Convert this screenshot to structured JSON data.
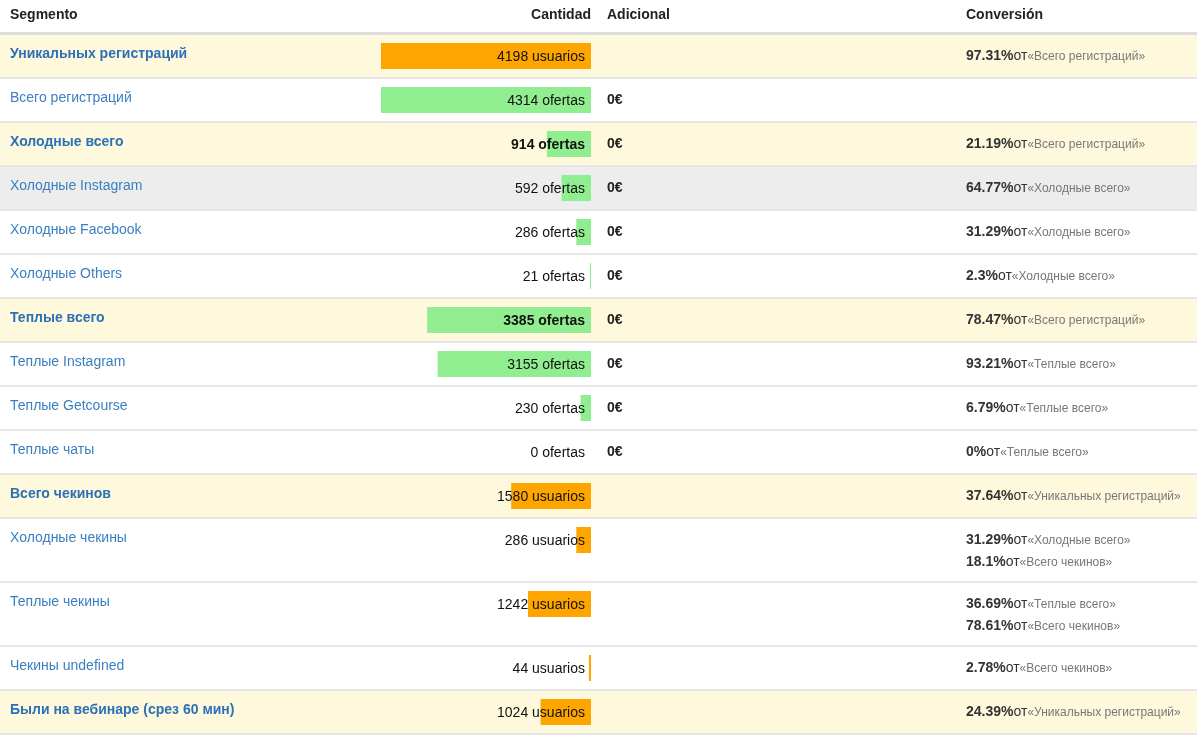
{
  "columns": [
    "Segmento",
    "Cantidad",
    "Adicional",
    "Conversión"
  ],
  "rows": [
    {
      "kind": "group",
      "highlighted": false,
      "segment": "Уникальных регистраций",
      "amount": "4198 usuarios",
      "amount_bold": false,
      "color": "#ffa500",
      "level": 1.0,
      "extra": "",
      "conversion": [
        {
          "percent": "97.31%",
          "of": "от",
          "reference": "«Всего регистраций»"
        }
      ]
    },
    {
      "kind": "item",
      "highlighted": false,
      "segment": "Всего регистраций",
      "amount": "4314 ofertas",
      "amount_bold": false,
      "color": "#90ee90",
      "level": 1.0,
      "extra": "0€",
      "conversion": []
    },
    {
      "kind": "group",
      "highlighted": false,
      "segment": "Холодные всего",
      "amount": "914 ofertas",
      "amount_bold": true,
      "color": "#90ee90",
      "level": 0.21,
      "extra": "0€",
      "conversion": [
        {
          "percent": "21.19%",
          "of": "от",
          "reference": "«Всего регистраций»"
        }
      ]
    },
    {
      "kind": "item",
      "highlighted": true,
      "segment": "Холодные Instagram",
      "amount": "592 ofertas",
      "amount_bold": false,
      "color": "#90ee90",
      "level": 0.14,
      "extra": "0€",
      "conversion": [
        {
          "percent": "64.77%",
          "of": "от",
          "reference": "«Холодные всего»"
        }
      ]
    },
    {
      "kind": "item",
      "highlighted": false,
      "segment": "Холодные Facebook",
      "amount": "286 ofertas",
      "amount_bold": false,
      "color": "#90ee90",
      "level": 0.07,
      "extra": "0€",
      "conversion": [
        {
          "percent": "31.29%",
          "of": "от",
          "reference": "«Холодные всего»"
        }
      ]
    },
    {
      "kind": "item",
      "highlighted": false,
      "segment": "Холодные Others",
      "amount": "21 ofertas",
      "amount_bold": false,
      "color": "#90ee90",
      "level": 0.005,
      "extra": "0€",
      "conversion": [
        {
          "percent": "2.3%",
          "of": "от",
          "reference": "«Холодные всего»"
        }
      ]
    },
    {
      "kind": "group",
      "highlighted": false,
      "segment": "Теплые всего",
      "amount": "3385 ofertas",
      "amount_bold": true,
      "color": "#90ee90",
      "level": 0.78,
      "extra": "0€",
      "conversion": [
        {
          "percent": "78.47%",
          "of": "от",
          "reference": "«Всего регистраций»"
        }
      ]
    },
    {
      "kind": "item",
      "highlighted": false,
      "segment": "Теплые Instagram",
      "amount": "3155 ofertas",
      "amount_bold": false,
      "color": "#90ee90",
      "level": 0.73,
      "extra": "0€",
      "conversion": [
        {
          "percent": "93.21%",
          "of": "от",
          "reference": "«Теплые всего»"
        }
      ]
    },
    {
      "kind": "item",
      "highlighted": false,
      "segment": "Теплые Getcourse",
      "amount": "230 ofertas",
      "amount_bold": false,
      "color": "#90ee90",
      "level": 0.05,
      "extra": "0€",
      "conversion": [
        {
          "percent": "6.79%",
          "of": "от",
          "reference": "«Теплые всего»"
        }
      ]
    },
    {
      "kind": "item",
      "highlighted": false,
      "segment": "Теплые чаты",
      "amount": "0 ofertas",
      "amount_bold": false,
      "extra": "0€",
      "conversion": [
        {
          "percent": "0%",
          "of": "от",
          "reference": "«Теплые всего»"
        }
      ]
    },
    {
      "kind": "group",
      "highlighted": false,
      "segment": "Всего чекинов",
      "amount": "1580 usuarios",
      "amount_bold": false,
      "color": "#ffa500",
      "level": 0.38,
      "extra": "",
      "conversion": [
        {
          "percent": "37.64%",
          "of": "от",
          "reference": "«Уникальных регистраций»"
        }
      ]
    },
    {
      "kind": "item",
      "highlighted": false,
      "segment": "Холодные чекины",
      "amount": "286 usuarios",
      "amount_bold": false,
      "color": "#ffa500",
      "level": 0.07,
      "extra": "",
      "conversion": [
        {
          "percent": "31.29%",
          "of": "от",
          "reference": "«Холодные всего»"
        },
        {
          "percent": "18.1%",
          "of": "от",
          "reference": "«Всего чекинов»"
        }
      ]
    },
    {
      "kind": "item",
      "highlighted": false,
      "segment": "Теплые чекины",
      "amount": "1242 usuarios",
      "amount_bold": false,
      "color": "#ffa500",
      "level": 0.3,
      "extra": "",
      "conversion": [
        {
          "percent": "36.69%",
          "of": "от",
          "reference": "«Теплые всего»"
        },
        {
          "percent": "78.61%",
          "of": "от",
          "reference": "«Всего чекинов»"
        }
      ]
    },
    {
      "kind": "item",
      "highlighted": false,
      "segment": "Чекины undefined",
      "amount": "44 usuarios",
      "amount_bold": false,
      "color": "#ffa500",
      "level": 0.01,
      "extra": "",
      "conversion": [
        {
          "percent": "2.78%",
          "of": "от",
          "reference": "«Всего чекинов»"
        }
      ]
    },
    {
      "kind": "group",
      "highlighted": false,
      "segment": "Были на вебинаре (срез 60 мин)",
      "amount": "1024 usuarios",
      "amount_bold": false,
      "color": "#ffa500",
      "level": 0.24,
      "extra": "",
      "conversion": [
        {
          "percent": "24.39%",
          "of": "от",
          "reference": "«Уникальных регистраций»"
        }
      ]
    }
  ]
}
